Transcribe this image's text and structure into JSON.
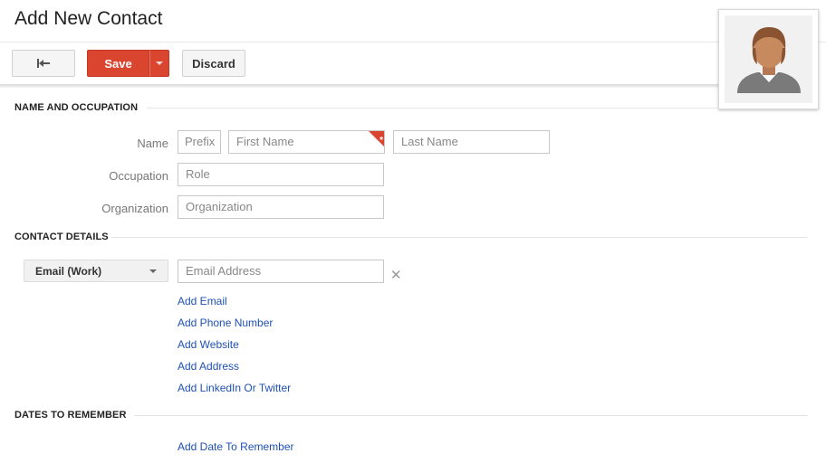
{
  "page": {
    "title": "Add New Contact"
  },
  "toolbar": {
    "back_icon": "back-arrow-icon",
    "save_label": "Save",
    "save_dropdown_icon": "chevron-down-icon",
    "discard_label": "Discard"
  },
  "avatar": {
    "icon": "person-avatar-icon"
  },
  "sections": {
    "name_occupation": "NAME AND OCCUPATION",
    "contact_details": "CONTACT DETAILS",
    "dates": "DATES TO REMEMBER"
  },
  "name_row": {
    "label": "Name",
    "prefix_placeholder": "Prefix",
    "first_placeholder": "First Name",
    "last_placeholder": "Last Name",
    "required_marker": "*"
  },
  "occupation_row": {
    "label": "Occupation",
    "placeholder": "Role"
  },
  "organization_row": {
    "label": "Organization",
    "placeholder": "Organization"
  },
  "contact": {
    "type_selected": "Email (Work)",
    "email_placeholder": "Email Address",
    "remove_icon": "close-icon",
    "remove_glyph": "✕",
    "links": [
      "Add Email",
      "Add Phone Number",
      "Add Website",
      "Add Address",
      "Add LinkedIn Or Twitter"
    ]
  },
  "dates": {
    "add_label": "Add Date To Remember"
  },
  "colors": {
    "save_red": "#d9452f",
    "link_blue": "#1f51b5"
  }
}
